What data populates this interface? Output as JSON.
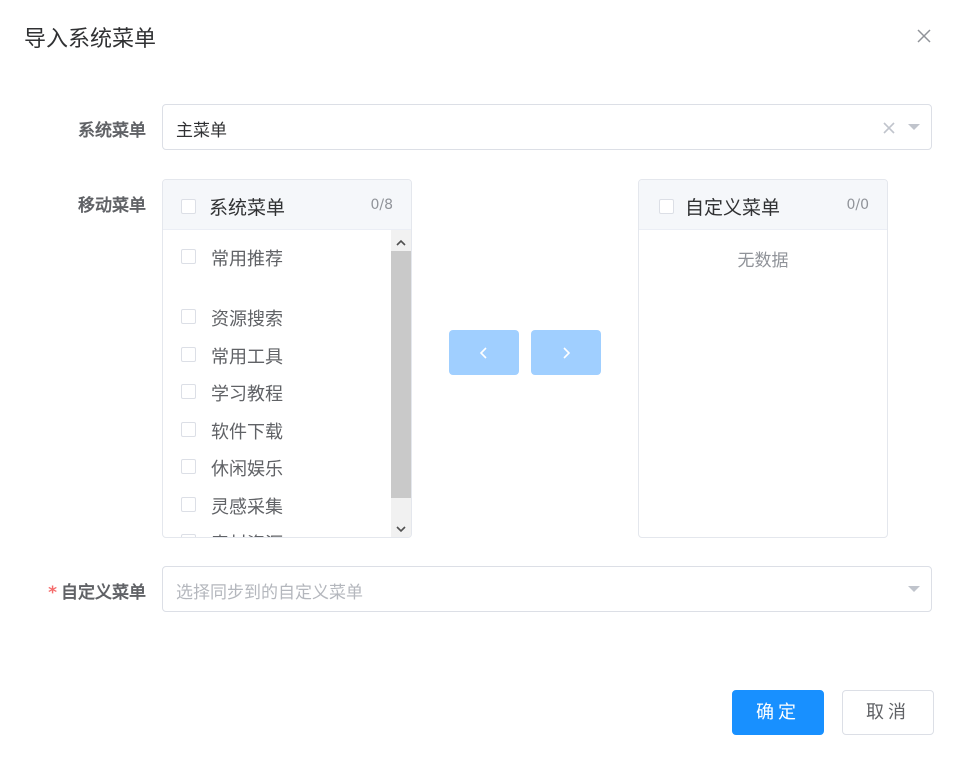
{
  "dialog": {
    "title": "导入系统菜单"
  },
  "form": {
    "system_menu": {
      "label": "系统菜单",
      "value": "主菜单"
    },
    "move_menu": {
      "label": "移动菜单"
    },
    "custom_menu": {
      "required_mark": "*",
      "label": "自定义菜单",
      "placeholder": "选择同步到的自定义菜单"
    }
  },
  "transfer": {
    "left": {
      "title": "系统菜单",
      "count": "0/8",
      "items": [
        {
          "label": "常用推荐"
        },
        {
          "label": "资源搜索"
        },
        {
          "label": "常用工具"
        },
        {
          "label": "学习教程"
        },
        {
          "label": "软件下载"
        },
        {
          "label": "休闲娱乐"
        },
        {
          "label": "灵感采集"
        },
        {
          "label": "素材资源"
        }
      ]
    },
    "right": {
      "title": "自定义菜单",
      "count": "0/0",
      "empty_text": "无数据"
    }
  },
  "footer": {
    "confirm_label": "确定",
    "cancel_label": "取消"
  },
  "colors": {
    "primary": "#1890ff",
    "transfer_button": "#a0cfff",
    "required": "#f56c6c"
  }
}
